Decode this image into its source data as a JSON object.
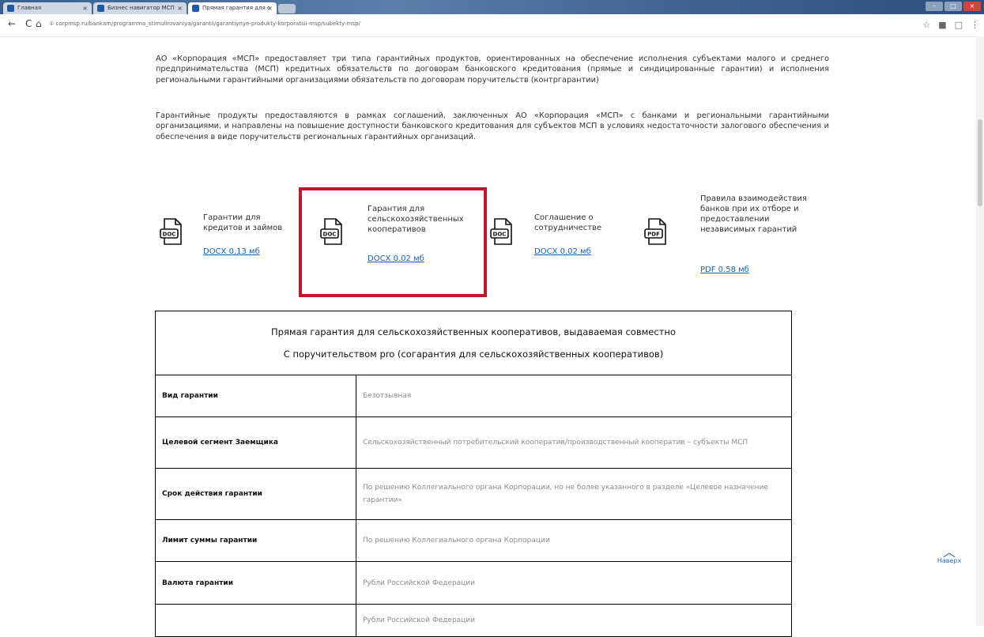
{
  "browser": {
    "tabs": [
      {
        "label": "Главная"
      },
      {
        "label": "Бизнес навигатор МСП"
      },
      {
        "label": "Прямая гарантия для с"
      }
    ],
    "url": "① corpmsp.ru/bankam/programma_stimulirovaniya/garantii/garantiynye-produkty-korporatsii-msp/subekty-msp/",
    "back": "←",
    "reload": "C",
    "home": "⌂"
  },
  "intro": {
    "paragraph1": "АО «Корпорация «МСП» предоставляет три типа гарантийных продуктов, ориентированных на обеспечение исполнения субъектами малого и среднего предпринимательства (МСП) кредитных обязательств по договорам банковского кредитования (прямые и синдицированные гарантии) и исполнения региональными гарантийными организациями обязательств по договорам поручительств (контргарантии)",
    "paragraph2": "Гарантийные продукты предоставляются в рамках соглашений, заключенных АО «Корпорация «МСП» с банками и региональными гарантийными организациями, и направлены на повышение доступности банковского кредитования для субъектов МСП в условиях недостаточности залогового обеспечения и обеспечения в виде поручительств региональных гарантийных организаций."
  },
  "documents": [
    {
      "icon": "DOC",
      "title": "Гарантии для кредитов и займов",
      "link": "DOCX 0.13 мб"
    },
    {
      "icon": "DOC",
      "title": "Гарантия для сельскохозяйственных кооперативов",
      "link": "DOCX 0.02 мб"
    },
    {
      "icon": "DOC",
      "title": "Соглашение о сотрудничестве",
      "link": "DOCX 0.02 мб"
    },
    {
      "icon": "PDF",
      "title": "Правила взаимодействия банков при их отборе и предоставлении независимых гарантий",
      "link": "PDF 0.58 мб"
    }
  ],
  "table": {
    "heading_line1": "Прямая гарантия для сельскохозяйственных кооперативов, выдаваемая совместно",
    "heading_line2": "С поручительством pro (согарантия для сельскохозяйственных кооперативов)",
    "rows": [
      {
        "label": "Вид гарантии",
        "value": "Безотзывная"
      },
      {
        "label": "Целевой сегмент Заемщика",
        "value": "Сельскохозяйственный потребительский кооператив/производственный кооператив – субъекты МСП"
      },
      {
        "label": "Срок действия гарантии",
        "value": "По решению Коллегиального органа Корпорации, но не более указанного в разделе «Целевое назначение гарантии»"
      },
      {
        "label": "Лимит суммы гарантии",
        "value": "По решению Коллегиального органа Корпорации"
      },
      {
        "label": "Валюта гарантии",
        "value": "Рубли Российской Федерации"
      },
      {
        "label": "",
        "value": "Рубли Российской Федерации"
      }
    ]
  },
  "scroll_top": {
    "label": "Наверх"
  }
}
